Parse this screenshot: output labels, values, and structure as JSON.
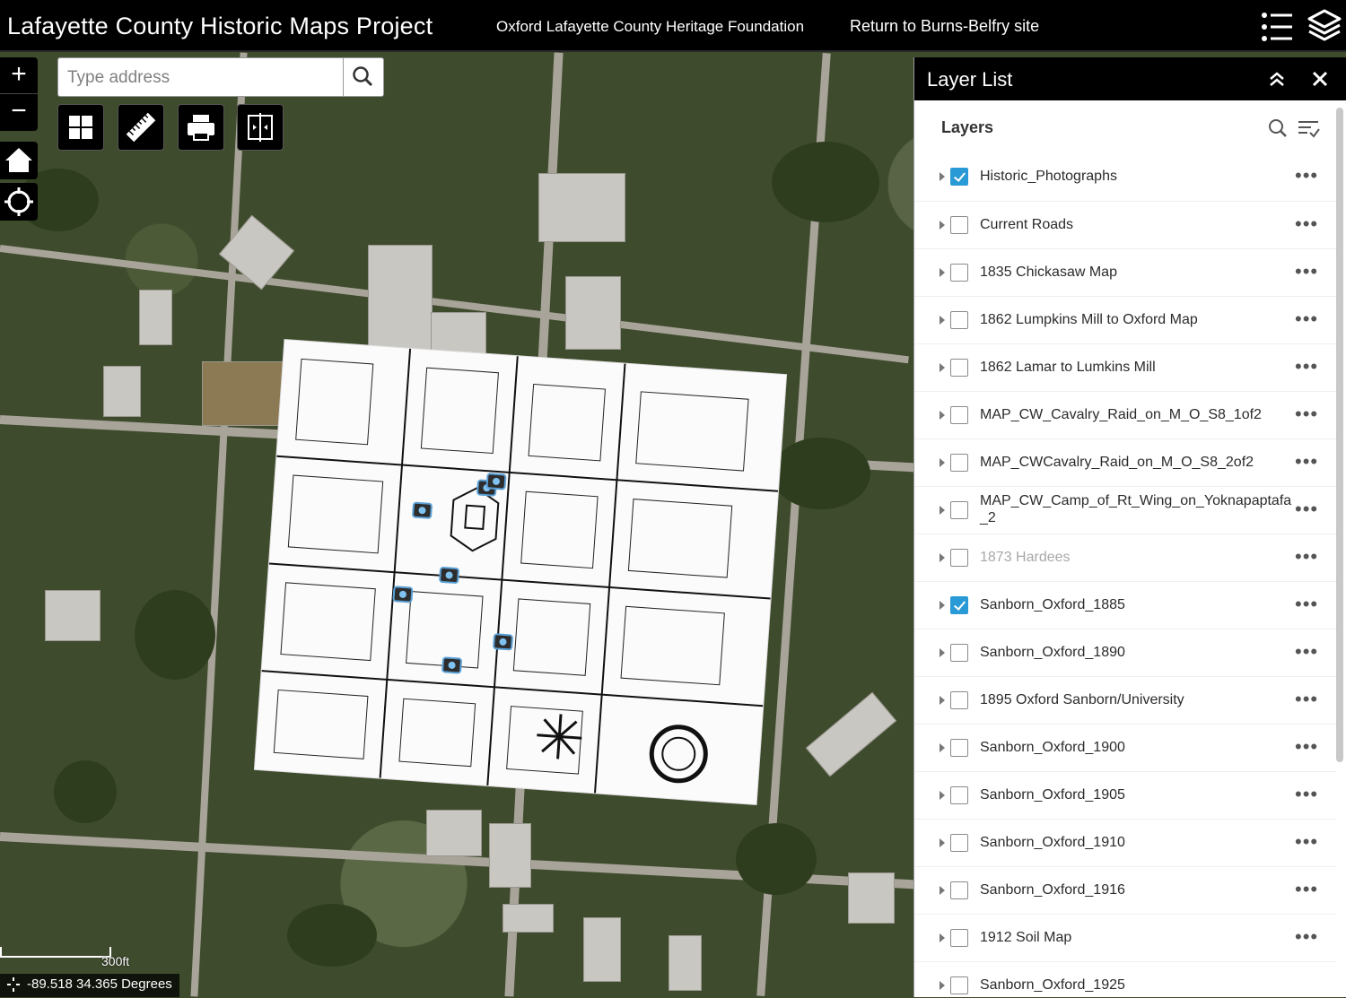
{
  "header": {
    "title": "Lafayette County Historic Maps Project",
    "link1": "Oxford Lafayette County Heritage Foundation",
    "link2": "Return to Burns-Belfry site",
    "icons": [
      "list-icon",
      "layers-icon"
    ]
  },
  "search": {
    "placeholder": "Type address",
    "value": ""
  },
  "map": {
    "scale_label": "300ft",
    "coordinates": "-89.518 34.365 Degrees",
    "widgets": [
      "basemap-gallery-icon",
      "measure-icon",
      "print-icon",
      "swipe-icon",
      "home-icon",
      "locate-icon"
    ]
  },
  "layer_panel": {
    "title": "Layer List",
    "heading": "Layers",
    "layers": [
      {
        "label": "Historic_Photographs",
        "checked": true,
        "dim": false
      },
      {
        "label": "Current Roads",
        "checked": false,
        "dim": false
      },
      {
        "label": "1835 Chickasaw Map",
        "checked": false,
        "dim": false
      },
      {
        "label": "1862 Lumpkins Mill to Oxford Map",
        "checked": false,
        "dim": false
      },
      {
        "label": "1862 Lamar to Lumkins Mill",
        "checked": false,
        "dim": false
      },
      {
        "label": "MAP_CW_Cavalry_Raid_on_M_O_S8_1of2",
        "checked": false,
        "dim": false
      },
      {
        "label": "MAP_CWCavalry_Raid_on_M_O_S8_2of2",
        "checked": false,
        "dim": false
      },
      {
        "label": "MAP_CW_Camp_of_Rt_Wing_on_Yoknapaptafa_2",
        "checked": false,
        "dim": false
      },
      {
        "label": "1873 Hardees",
        "checked": false,
        "dim": true
      },
      {
        "label": "Sanborn_Oxford_1885",
        "checked": true,
        "dim": false
      },
      {
        "label": "Sanborn_Oxford_1890",
        "checked": false,
        "dim": false
      },
      {
        "label": "1895 Oxford Sanborn/University",
        "checked": false,
        "dim": false
      },
      {
        "label": "Sanborn_Oxford_1900",
        "checked": false,
        "dim": false
      },
      {
        "label": "Sanborn_Oxford_1905",
        "checked": false,
        "dim": false
      },
      {
        "label": "Sanborn_Oxford_1910",
        "checked": false,
        "dim": false
      },
      {
        "label": "Sanborn_Oxford_1916",
        "checked": false,
        "dim": false
      },
      {
        "label": "1912 Soil Map",
        "checked": false,
        "dim": false
      },
      {
        "label": "Sanborn_Oxford_1925",
        "checked": false,
        "dim": false
      }
    ],
    "accent_color": "#2a9ad6"
  }
}
